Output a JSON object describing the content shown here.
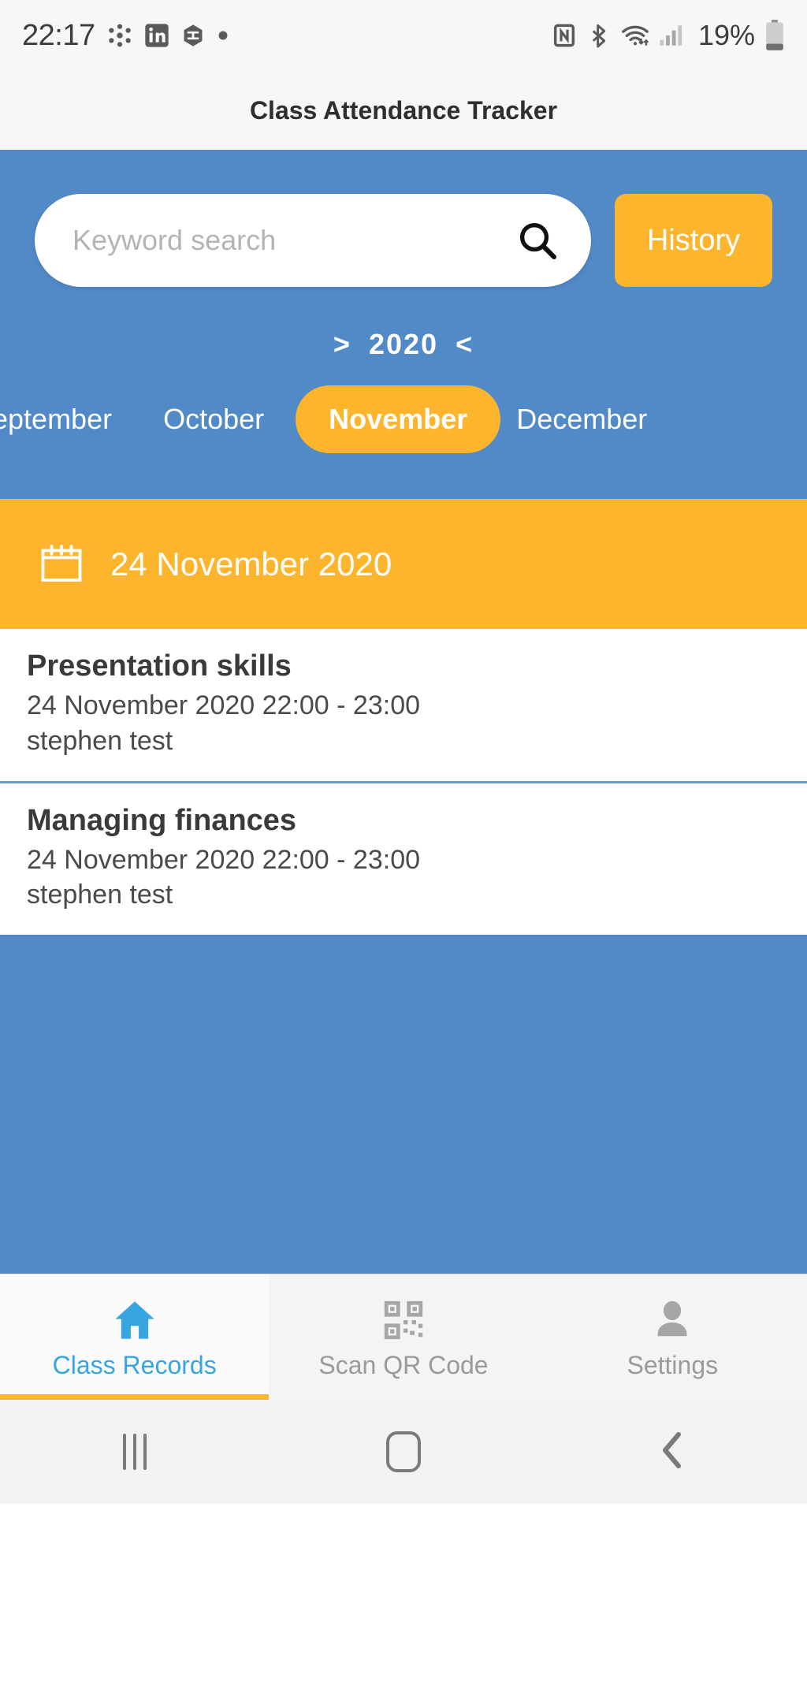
{
  "status_bar": {
    "time": "22:17",
    "left_icons": [
      "cluster-icon",
      "linkedin-icon",
      "hexagon-icon",
      "dot-icon"
    ],
    "right_icons": [
      "nfc-icon",
      "bluetooth-icon",
      "wifi-icon",
      "cellular-signal-icon"
    ],
    "battery_percent": "19%"
  },
  "app": {
    "title": "Class Attendance Tracker"
  },
  "search": {
    "placeholder": "Keyword search",
    "value": "",
    "icon": "search-icon",
    "history_label": "History"
  },
  "year_selector": {
    "prev_arrow": ">",
    "year": "2020",
    "next_arrow": "<"
  },
  "months": [
    {
      "label": "eptember",
      "full": "September",
      "selected": false
    },
    {
      "label": "October",
      "full": "October",
      "selected": false
    },
    {
      "label": "November",
      "full": "November",
      "selected": true
    },
    {
      "label": "December",
      "full": "December",
      "selected": false
    }
  ],
  "date_banner": {
    "icon": "calendar-icon",
    "date": "24 November 2020"
  },
  "classes": [
    {
      "title": "Presentation skills",
      "schedule": "24 November 2020 22:00 - 23:00",
      "teacher": "stephen test"
    },
    {
      "title": "Managing finances",
      "schedule": "24 November 2020 22:00 - 23:00",
      "teacher": "stephen test"
    }
  ],
  "tabs": [
    {
      "label": "Class Records",
      "icon": "home-icon",
      "active": true
    },
    {
      "label": "Scan QR Code",
      "icon": "qr-code-icon",
      "active": false
    },
    {
      "label": "Settings",
      "icon": "person-icon",
      "active": false
    }
  ],
  "system_nav": {
    "recents": "recents-icon",
    "home": "home-square-icon",
    "back": "back-chevron-icon"
  },
  "colors": {
    "primary_blue": "#5289c7",
    "accent_yellow": "#fcb52c",
    "active_tab_blue": "#36a5e0"
  }
}
